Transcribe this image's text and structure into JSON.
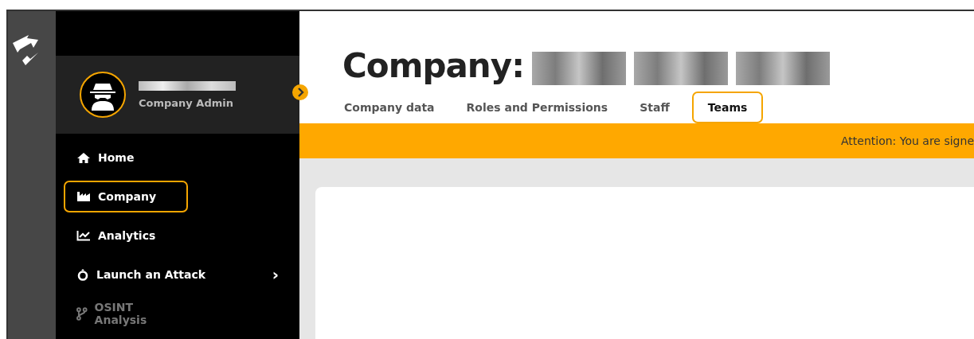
{
  "user": {
    "role": "Company Admin"
  },
  "nav": [
    {
      "label": "Home",
      "selected": false,
      "disabled": false,
      "kind": "link"
    },
    {
      "label": "Company",
      "selected": true,
      "disabled": false,
      "kind": "link"
    },
    {
      "label": "Analytics",
      "selected": false,
      "disabled": false,
      "kind": "link"
    },
    {
      "label": "Launch an Attack",
      "selected": false,
      "disabled": false,
      "kind": "submenu",
      "chevron": "›"
    },
    {
      "label": "OSINT Analysis",
      "selected": false,
      "disabled": true,
      "kind": "link"
    }
  ],
  "page": {
    "title": "Company:"
  },
  "tabs": [
    {
      "label": "Company data",
      "selected": false
    },
    {
      "label": "Roles and Permissions",
      "selected": false
    },
    {
      "label": "Staff",
      "selected": false
    },
    {
      "label": "Teams",
      "selected": true
    }
  ],
  "banner": {
    "text": "Attention: You are signe"
  }
}
